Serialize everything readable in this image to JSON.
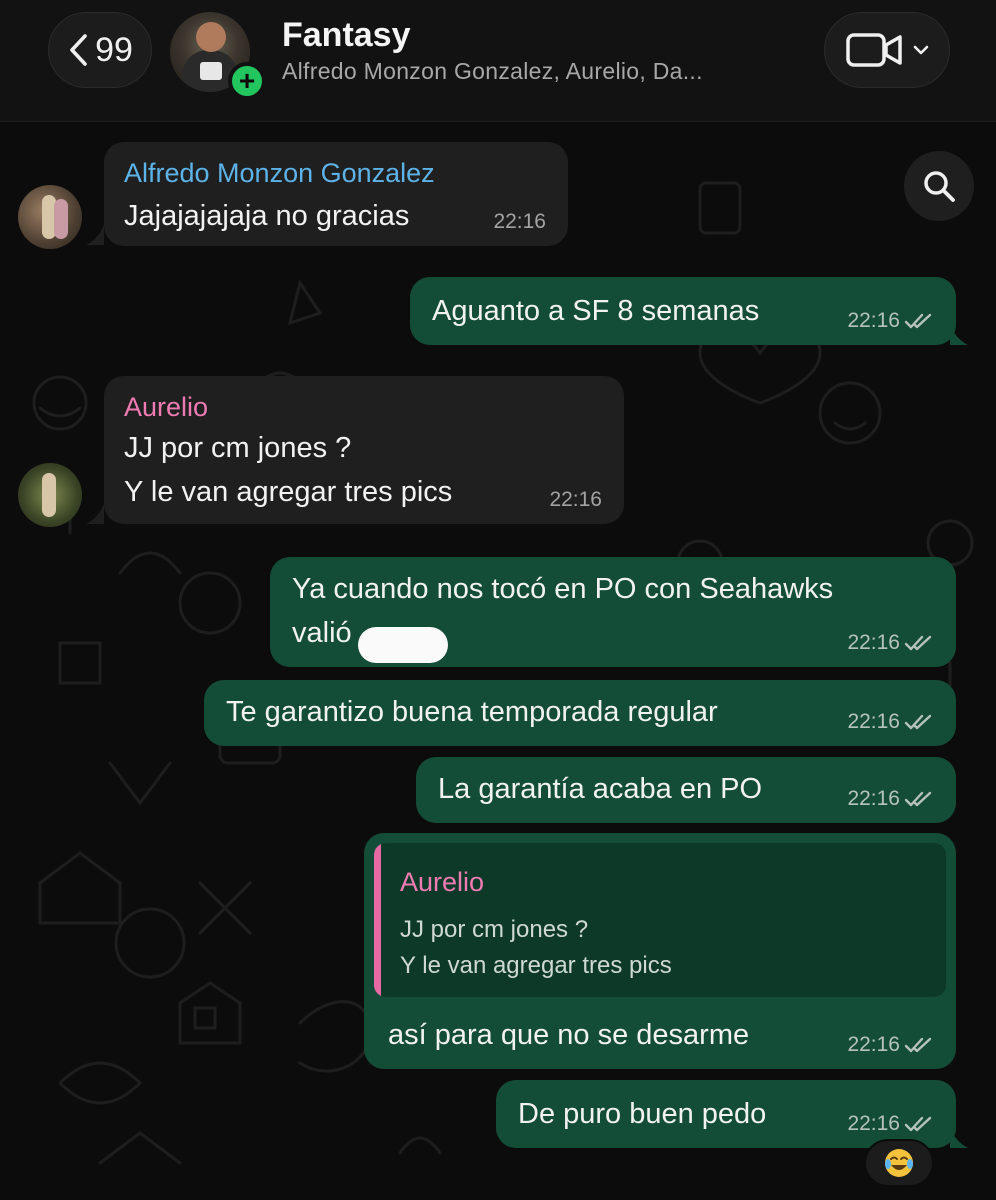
{
  "header": {
    "back_count": "99",
    "title": "Fantasy",
    "subtitle": "Alfredo Monzon Gonzalez, Aurelio, Da...",
    "add_icon": "+",
    "icons": [
      "chevron-left-icon",
      "video-camera-icon",
      "chevron-down-icon",
      "add-member-icon"
    ]
  },
  "colors": {
    "incoming_bubble": "#1f1f1f",
    "outgoing_bubble": "#134d37",
    "alfredo_name": "#5db3e8",
    "aurelio_name": "#ee7bb1",
    "accent_green": "#22c55e"
  },
  "messages": [
    {
      "sender": "Alfredo Monzon Gonzalez",
      "text": "Jajajajajaja no gracias",
      "time": "22:16"
    },
    {
      "text": "Aguanto a SF 8 semanas",
      "time": "22:16"
    },
    {
      "sender": "Aurelio",
      "line1": "JJ por cm jones ?",
      "line2": "Y le van agregar tres pics",
      "time": "22:16"
    },
    {
      "line1": "Ya cuando nos tocó en PO con Seahawks",
      "line2": "valió",
      "time": "22:16"
    },
    {
      "text": "Te garantizo buena temporada regular",
      "time": "22:16"
    },
    {
      "text": "La garantía acaba en PO",
      "time": "22:16"
    },
    {
      "quote_sender": "Aurelio",
      "quote_line1": "JJ por cm jones ?",
      "quote_line2": "Y le van agregar tres pics",
      "text": "así para que no se desarme",
      "time": "22:16"
    },
    {
      "text": "De puro buen pedo",
      "time": "22:16",
      "reaction": "😂"
    }
  ]
}
